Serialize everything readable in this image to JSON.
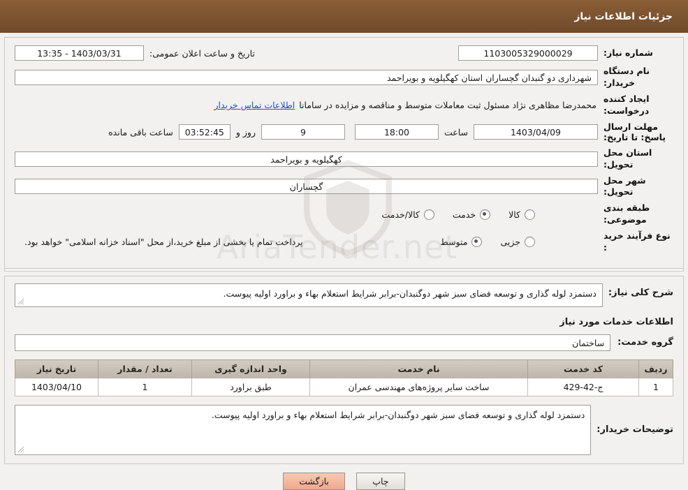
{
  "header": {
    "title": "جزئیات اطلاعات نیاز"
  },
  "form": {
    "need_number_label": "شماره نیاز:",
    "need_number_value": "1103005329000029",
    "announce_datetime_label": "تاریخ و ساعت اعلان عمومی:",
    "announce_datetime_value": "1403/03/31 - 13:35",
    "buyer_org_label": "نام دستگاه خریدار:",
    "buyer_org_value": "شهرداری دو گنبدان گچساران استان کهگیلویه و بویراحمد",
    "creator_label": "ایجاد کننده درخواست:",
    "creator_value": "محمدرضا مظاهری نژاد مسئول ثبت معاملات متوسط و مناقصه و مزایده در سامانا",
    "creator_link": "اطلاعات تماس خریدار",
    "deadline_label": "مهلت ارسال پاسخ: تا تاریخ:",
    "deadline_date": "1403/04/09",
    "time_label": "ساعت",
    "deadline_time": "18:00",
    "days_value": "9",
    "days_label": "روز و",
    "remaining_time": "03:52:45",
    "remaining_label": "ساعت باقی مانده",
    "province_label": "استان محل تحویل:",
    "province_value": "کهگیلویه و بویراحمد",
    "city_label": "شهر محل تحویل:",
    "city_value": "گچساران",
    "category_label": "طبقه بندی موضوعی:",
    "category_options": [
      {
        "label": "کالا",
        "selected": false
      },
      {
        "label": "خدمت",
        "selected": true
      },
      {
        "label": "کالا/خدمت",
        "selected": false
      }
    ],
    "purchase_type_label": "نوع فرآیند خرید :",
    "purchase_type_options": [
      {
        "label": "جزیی",
        "selected": false
      },
      {
        "label": "متوسط",
        "selected": true
      }
    ],
    "purchase_note": "پرداخت تمام یا بخشی از مبلغ خرید،از محل \"اسناد خزانه اسلامی\" خواهد بود."
  },
  "details": {
    "general_desc_label": "شرح کلی نیاز:",
    "general_desc_value": "دستمزد لوله گذاری و توسعه فضای سبز شهر دوگنبدان-برابر شرایط استعلام بهاء و براورد اولیه پیوست.",
    "services_head": "اطلاعات خدمات مورد نیاز",
    "service_group_label": "گروه خدمت:",
    "service_group_value": "ساختمان",
    "table": {
      "columns": [
        "ردیف",
        "کد خدمت",
        "نام خدمت",
        "واحد اندازه گیری",
        "تعداد / مقدار",
        "تاریخ نیاز"
      ],
      "rows": [
        {
          "row": "1",
          "code": "ج-42-429",
          "name": "ساخت سایر پروژه‌های مهندسی عمران",
          "unit": "طبق براورد",
          "qty": "1",
          "date": "1403/04/10"
        }
      ]
    },
    "buyer_notes_label": "توضیحات خریدار:",
    "buyer_notes_value": "دستمزد لوله گذاری و توسعه فضای سبز شهر دوگنبدان-برابر شرایط استعلام بهاء و براورد اولیه پیوست."
  },
  "footer": {
    "print_label": "چاپ",
    "back_label": "بازگشت"
  },
  "watermark": {
    "text": "AriaTender.net"
  }
}
